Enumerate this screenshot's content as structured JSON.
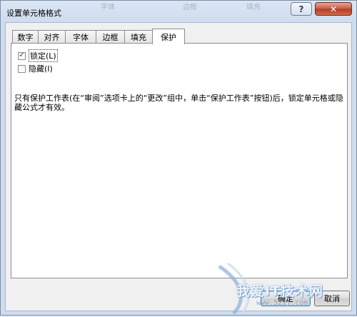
{
  "window": {
    "title": "设置单元格格式",
    "ghost_labels": [
      "字体",
      "边框",
      "填充"
    ],
    "help_label": "?",
    "close_label": "✕"
  },
  "tabs": [
    {
      "label": "数字"
    },
    {
      "label": "对齐"
    },
    {
      "label": "字体"
    },
    {
      "label": "边框"
    },
    {
      "label": "填充"
    },
    {
      "label": "保护"
    }
  ],
  "protection": {
    "locked": {
      "label": "锁定(L)",
      "checked": true,
      "mark": "✓"
    },
    "hidden": {
      "label": "隐藏(I)",
      "checked": false
    },
    "description": "只有保护工作表(在“审阅”选项卡上的“更改”组中，单击“保护工作表”按钮)后，锁定单元格或隐藏公式才有效。"
  },
  "buttons": {
    "ok": "确定",
    "cancel": "取消"
  },
  "watermark": {
    "text": "我爱IT技术网",
    "url": "www.52ij.com"
  }
}
